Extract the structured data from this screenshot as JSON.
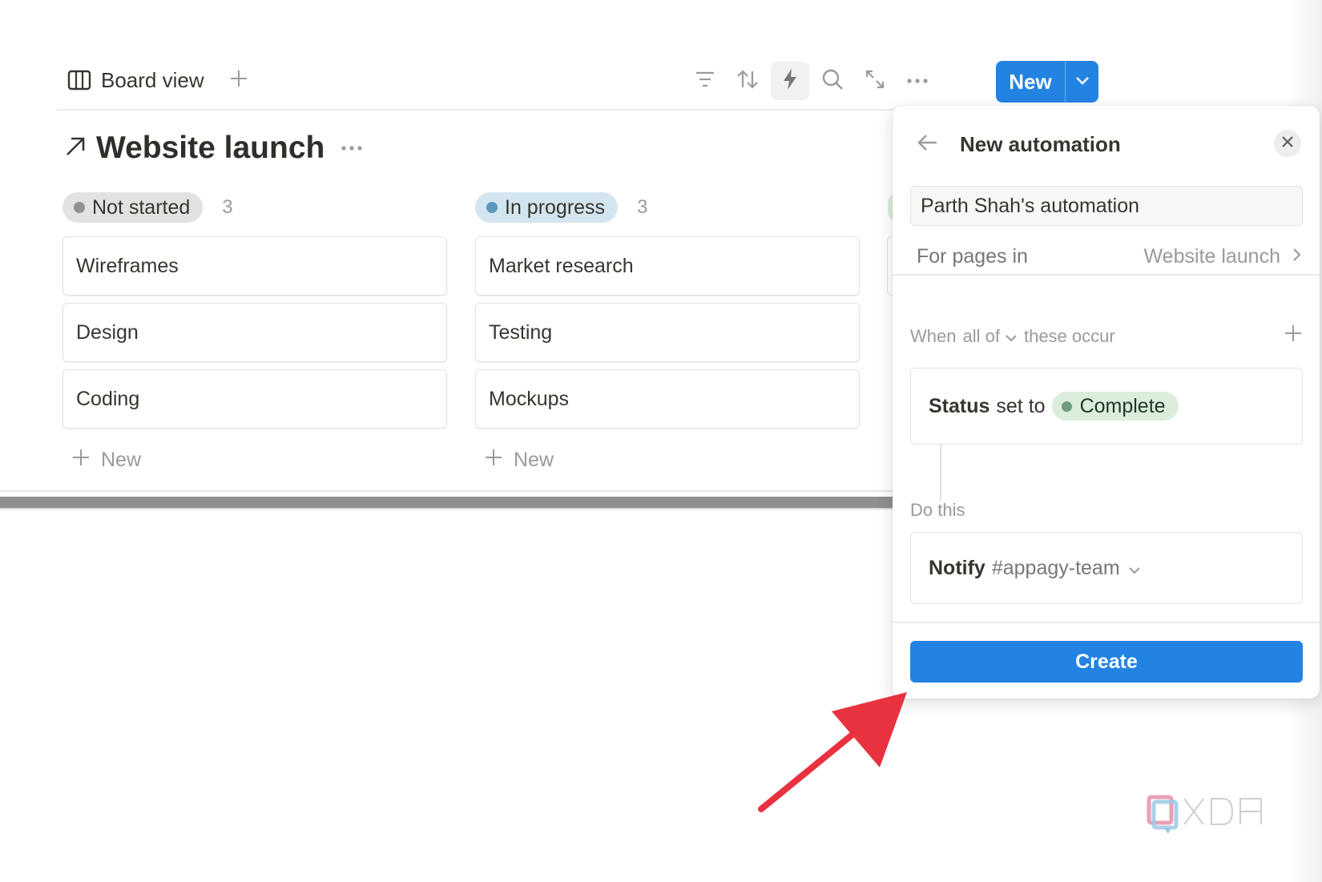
{
  "toolbar": {
    "view_label": "Board view",
    "new_label": "New",
    "icons": [
      "board-view-icon",
      "plus-icon",
      "filter-icon",
      "sort-icon",
      "automation-lightning-icon",
      "search-icon",
      "expand-icon",
      "more-icon",
      "chevron-down-icon"
    ]
  },
  "board": {
    "title": "Website launch",
    "columns": [
      {
        "status": "Not started",
        "count": "3",
        "pill_bg": "#e3e2e0",
        "dot": "#91918e",
        "cards": [
          "Wireframes",
          "Design",
          "Coding"
        ],
        "add_label": "New"
      },
      {
        "status": "In progress",
        "count": "3",
        "pill_bg": "#d3e5ef",
        "dot": "#5b97bd",
        "cards": [
          "Market research",
          "Testing",
          "Mockups"
        ],
        "add_label": "New"
      }
    ]
  },
  "panel": {
    "title": "New automation",
    "name_value": "Parth Shah's automation",
    "for_pages_label": "For pages in",
    "for_pages_value": "Website launch",
    "when_prefix": "When",
    "when_select": "all of",
    "when_suffix": "these occur",
    "trigger": {
      "property": "Status",
      "middle": "set to",
      "value": "Complete"
    },
    "do_this_label": "Do this",
    "action": {
      "verb": "Notify",
      "channel": "#appagy-team"
    },
    "create_label": "Create"
  },
  "colors": {
    "accent": "#2383e2",
    "annotation_arrow": "#e8323f",
    "complete_green": "#dbeddb"
  }
}
